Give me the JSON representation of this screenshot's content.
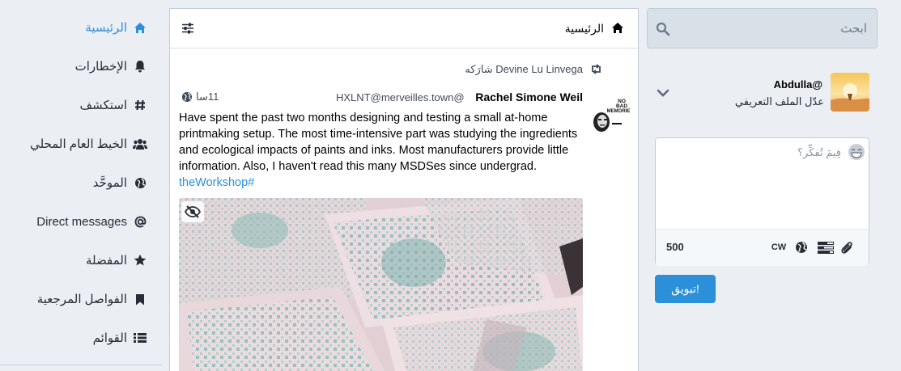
{
  "search": {
    "placeholder": "ابحث"
  },
  "account": {
    "handle": "Abdulla@",
    "edit_profile": "عدّل الملف التعريفي"
  },
  "compose": {
    "placeholder": "فِيمَ تُفكِّر؟",
    "char_count": "500",
    "cw_label": "CW",
    "submit_label": "!تبويق"
  },
  "column": {
    "title": "الرئيسية"
  },
  "post": {
    "boost_line": "Devine Lu Linvega شارَكه",
    "author_name": "Rachel Simone Weil",
    "author_handle": "HXLNT@merveilles.town@",
    "time": "11سا",
    "avatar_caption": "NO BAD MEMORIES",
    "body": "Have spent the past two months designing and testing a small at-home printmaking setup. The most time-intensive part was studying the ingredients and ecological impacts of paints and inks. Most manufacturers provide little information. Also, I haven't read this many MSDSes since undergrad.",
    "hashtag": "theWorkshop#"
  },
  "nav": {
    "items": [
      {
        "label": "الرئيسية",
        "icon": "home-icon",
        "active": true
      },
      {
        "label": "الإخطارات",
        "icon": "bell-icon"
      },
      {
        "label": "استكشف",
        "icon": "hashtag-icon"
      },
      {
        "label": "الخيط العام المحلي",
        "icon": "users-icon"
      },
      {
        "label": "الموحَّد",
        "icon": "globe-icon"
      },
      {
        "label": "Direct messages",
        "icon": "at-icon"
      },
      {
        "label": "المفضلة",
        "icon": "star-icon"
      },
      {
        "label": "الفواصل المرجعية",
        "icon": "bookmark-icon"
      },
      {
        "label": "القوائم",
        "icon": "list-icon"
      }
    ]
  },
  "colors": {
    "accent": "#2b90d9",
    "background": "#ebeef3",
    "panel": "#ffffff",
    "search_bg": "#d9e1e8"
  }
}
